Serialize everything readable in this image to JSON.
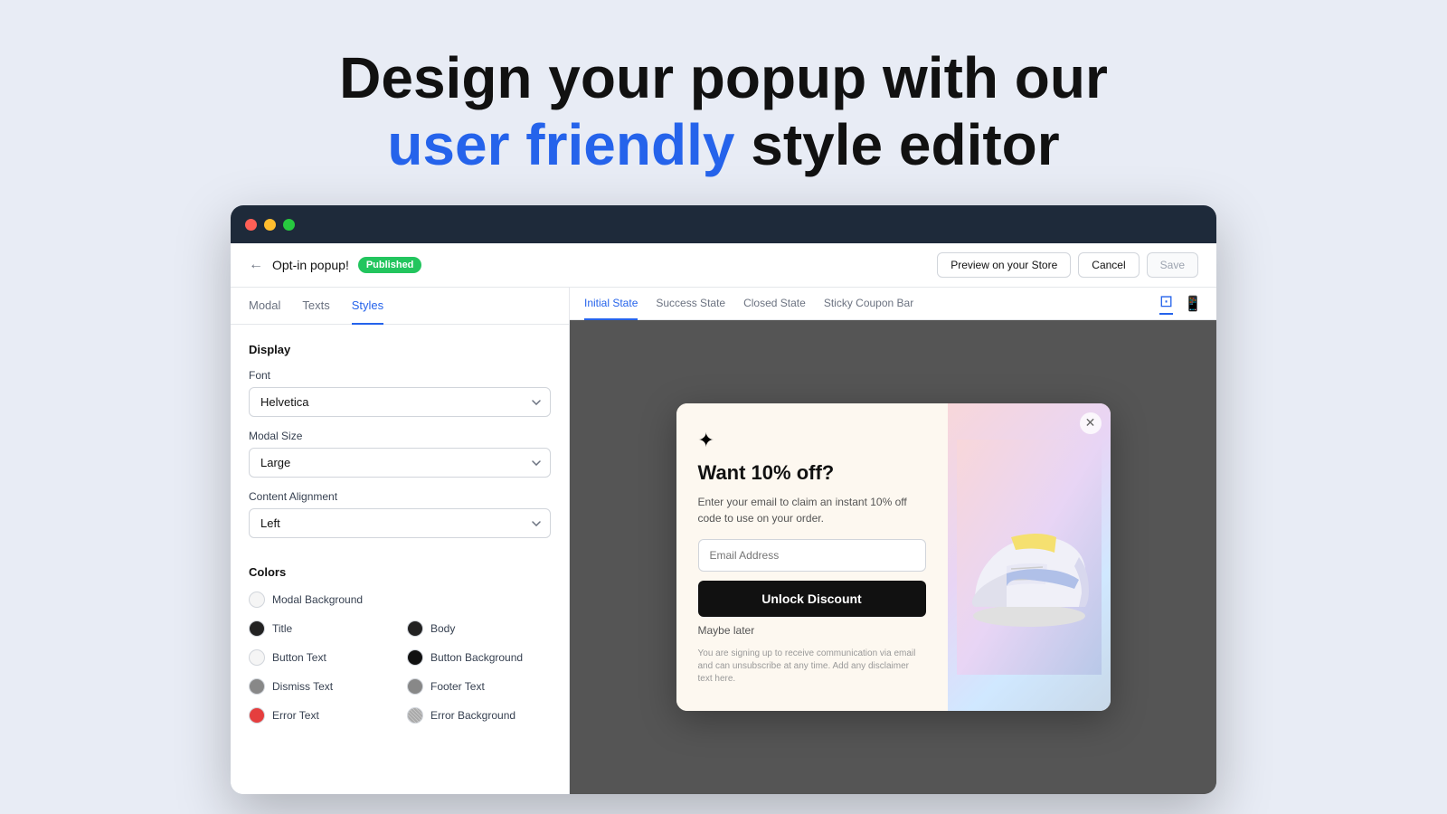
{
  "hero": {
    "line1": "Design your popup with our",
    "line2_blue": "user friendly",
    "line2_dark": " style editor"
  },
  "browser": {
    "dots": [
      "red",
      "yellow",
      "green"
    ]
  },
  "topbar": {
    "back_label": "←",
    "title": "Opt-in popup!",
    "badge": "Published",
    "preview_btn": "Preview on your Store",
    "cancel_btn": "Cancel",
    "save_btn": "Save"
  },
  "tabs": {
    "items": [
      "Modal",
      "Texts",
      "Styles"
    ],
    "active": "Styles"
  },
  "sidebar": {
    "display_label": "Display",
    "font_label": "Font",
    "font_value": "Helvetica",
    "modal_size_label": "Modal Size",
    "modal_size_value": "Large",
    "content_alignment_label": "Content Alignment",
    "content_alignment_value": "Left",
    "colors_label": "Colors",
    "color_items": [
      {
        "label": "Modal Background",
        "color": "#f5f5f5",
        "col": "left"
      },
      {
        "label": "Title",
        "color": "#222",
        "col": "left"
      },
      {
        "label": "Button Text",
        "color": "#f5f5f5",
        "col": "left"
      },
      {
        "label": "Dismiss Text",
        "color": "#888",
        "col": "left"
      },
      {
        "label": "Error Text",
        "color": "#e53e3e",
        "col": "left"
      },
      {
        "label": "Body",
        "color": "#222",
        "col": "right"
      },
      {
        "label": "Button Background",
        "color": "#111",
        "col": "right"
      },
      {
        "label": "Footer Text",
        "color": "#888",
        "col": "right"
      },
      {
        "label": "Error Background",
        "color": "#fee2e2",
        "col": "right"
      }
    ]
  },
  "preview": {
    "device_tabs": [
      "desktop",
      "mobile"
    ],
    "state_tabs": [
      "Initial State",
      "Success State",
      "Closed State",
      "Sticky Coupon Bar"
    ],
    "active_state": "Initial State"
  },
  "modal": {
    "star_icon": "✦",
    "headline": "Want 10% off?",
    "body": "Enter your email to claim an instant 10% off code to use on your order.",
    "email_placeholder": "Email Address",
    "cta_label": "Unlock Discount",
    "maybe_later": "Maybe later",
    "disclaimer": "You are signing up to receive communication via email and can unsubscribe at any time. Add any disclaimer text here."
  }
}
